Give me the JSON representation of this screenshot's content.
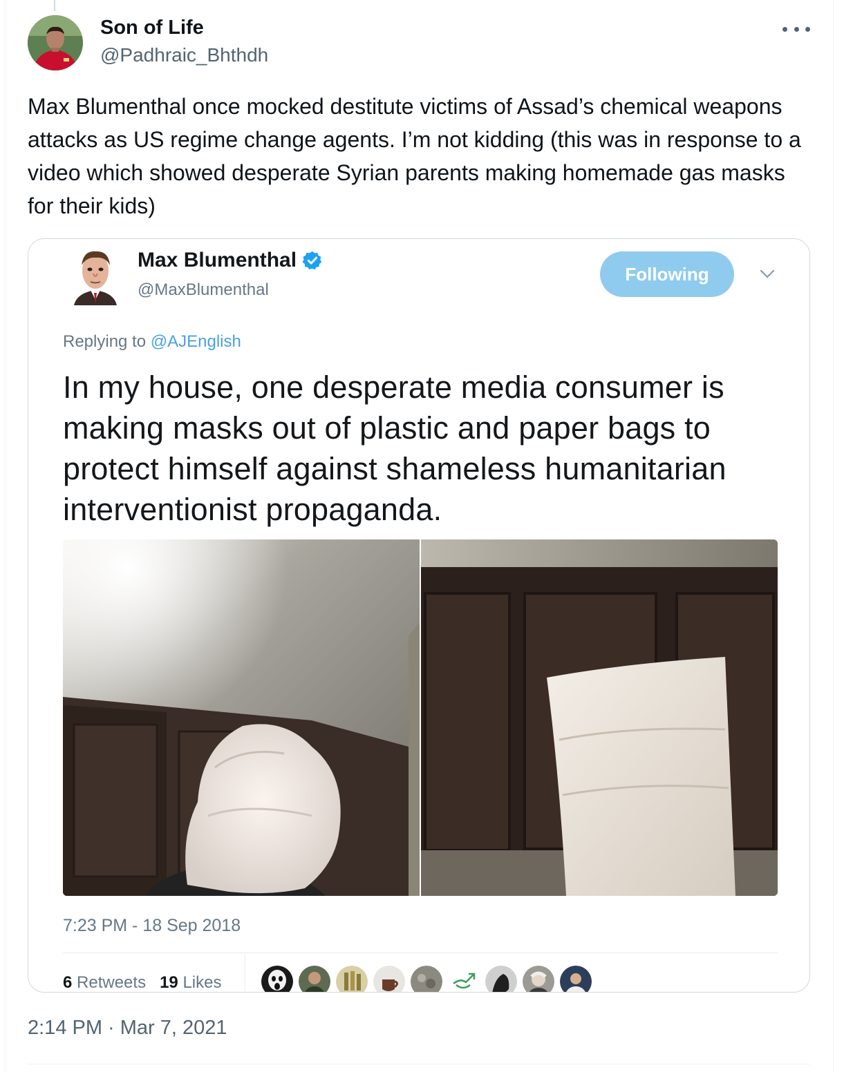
{
  "tweet": {
    "display_name": "Son of Life",
    "handle": "@Padhraic_Bhthdh",
    "text": "Max Blumenthal once mocked destitute victims of Assad’s chemical weapons attacks as US regime change agents. I’m not kidding (this was in response to a video which showed desperate Syrian parents making homemade gas masks for their kids)",
    "timestamp": "2:14 PM · Mar 7, 2021",
    "avatar_icon": "footballer-avatar-icon",
    "more_icon": "more-dots-icon"
  },
  "quoted": {
    "display_name": "Max Blumenthal",
    "handle": "@MaxBlumenthal",
    "verified_icon": "verified-badge-icon",
    "follow_label": "Following",
    "replying_prefix": "Replying to",
    "replying_to": "@AJEnglish",
    "text": "In my house, one desperate media consumer is making masks out of plastic and paper bags to protect himself against shameless humanitarian interventionist propaganda.",
    "timestamp": "7:23 PM - 18 Sep 2018",
    "retweets_count": "6",
    "retweets_label": "Retweets",
    "likes_count": "19",
    "likes_label": "Likes",
    "photos": [
      "plastic-bag-mask-photo",
      "paper-bag-mask-photo"
    ],
    "liker_count": 9
  },
  "colors": {
    "follow_button": "#8fcbee",
    "link": "#4aa0e6",
    "verified": "#1da1f2",
    "secondary_text": "#536471"
  }
}
